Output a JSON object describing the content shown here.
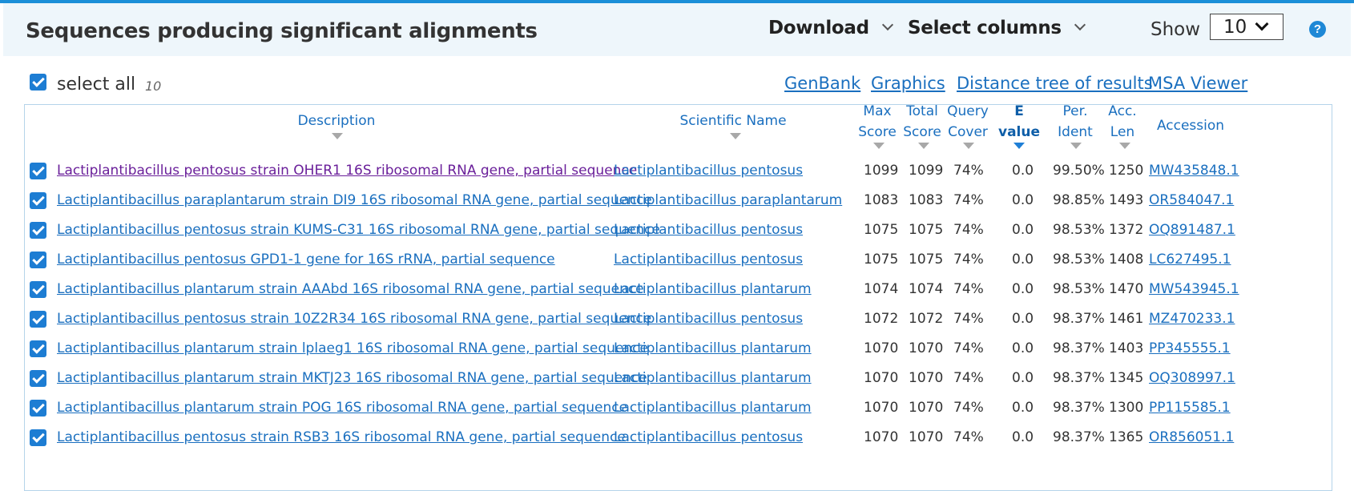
{
  "header": {
    "title": "Sequences producing significant alignments",
    "download_label": "Download",
    "select_columns_label": "Select columns",
    "show_label": "Show",
    "show_value": "10",
    "help_icon": "question-circle-icon"
  },
  "selection": {
    "select_all_label": "select all",
    "count": "10"
  },
  "links": {
    "genbank": "GenBank",
    "graphics": "Graphics",
    "distance_tree": "Distance tree of results",
    "msa_viewer": "MSA Viewer"
  },
  "columns": {
    "description": "Description",
    "scientific_name": "Scientific Name",
    "max_score_1": "Max",
    "max_score_2": "Score",
    "total_score_1": "Total",
    "total_score_2": "Score",
    "query_cover_1": "Query",
    "query_cover_2": "Cover",
    "evalue_1": "E",
    "evalue_2": "value",
    "per_ident_1": "Per.",
    "per_ident_2": "Ident",
    "acc_len_1": "Acc.",
    "acc_len_2": "Len",
    "accession": "Accession"
  },
  "rows": [
    {
      "description": "Lactiplantibacillus pentosus strain OHER1 16S ribosomal RNA gene, partial sequence",
      "scientific_name": "Lactiplantibacillus pentosus",
      "max_score": "1099",
      "total_score": "1099",
      "query_cover": "74%",
      "evalue": "0.0",
      "per_ident": "99.50%",
      "acc_len": "1250",
      "accession": "MW435848.1"
    },
    {
      "description": "Lactiplantibacillus paraplantarum strain DI9 16S ribosomal RNA gene, partial sequence",
      "scientific_name": "Lactiplantibacillus paraplantarum",
      "max_score": "1083",
      "total_score": "1083",
      "query_cover": "74%",
      "evalue": "0.0",
      "per_ident": "98.85%",
      "acc_len": "1493",
      "accession": "OR584047.1"
    },
    {
      "description": "Lactiplantibacillus pentosus strain KUMS-C31 16S ribosomal RNA gene, partial sequence",
      "scientific_name": "Lactiplantibacillus pentosus",
      "max_score": "1075",
      "total_score": "1075",
      "query_cover": "74%",
      "evalue": "0.0",
      "per_ident": "98.53%",
      "acc_len": "1372",
      "accession": "OQ891487.1"
    },
    {
      "description": "Lactiplantibacillus pentosus GPD1-1 gene for 16S rRNA, partial sequence",
      "scientific_name": "Lactiplantibacillus pentosus",
      "max_score": "1075",
      "total_score": "1075",
      "query_cover": "74%",
      "evalue": "0.0",
      "per_ident": "98.53%",
      "acc_len": "1408",
      "accession": "LC627495.1"
    },
    {
      "description": "Lactiplantibacillus plantarum strain AAAbd 16S ribosomal RNA gene, partial sequence",
      "scientific_name": "Lactiplantibacillus plantarum",
      "max_score": "1074",
      "total_score": "1074",
      "query_cover": "74%",
      "evalue": "0.0",
      "per_ident": "98.53%",
      "acc_len": "1470",
      "accession": "MW543945.1"
    },
    {
      "description": "Lactiplantibacillus pentosus strain 10Z2R34 16S ribosomal RNA gene, partial sequence",
      "scientific_name": "Lactiplantibacillus pentosus",
      "max_score": "1072",
      "total_score": "1072",
      "query_cover": "74%",
      "evalue": "0.0",
      "per_ident": "98.37%",
      "acc_len": "1461",
      "accession": "MZ470233.1"
    },
    {
      "description": "Lactiplantibacillus plantarum strain lplaeg1 16S ribosomal RNA gene, partial sequence",
      "scientific_name": "Lactiplantibacillus plantarum",
      "max_score": "1070",
      "total_score": "1070",
      "query_cover": "74%",
      "evalue": "0.0",
      "per_ident": "98.37%",
      "acc_len": "1403",
      "accession": "PP345555.1"
    },
    {
      "description": "Lactiplantibacillus plantarum strain MKTJ23 16S ribosomal RNA gene, partial sequence",
      "scientific_name": "Lactiplantibacillus plantarum",
      "max_score": "1070",
      "total_score": "1070",
      "query_cover": "74%",
      "evalue": "0.0",
      "per_ident": "98.37%",
      "acc_len": "1345",
      "accession": "OQ308997.1"
    },
    {
      "description": "Lactiplantibacillus plantarum strain POG 16S ribosomal RNA gene, partial sequence",
      "scientific_name": "Lactiplantibacillus plantarum",
      "max_score": "1070",
      "total_score": "1070",
      "query_cover": "74%",
      "evalue": "0.0",
      "per_ident": "98.37%",
      "acc_len": "1300",
      "accession": "PP115585.1"
    },
    {
      "description": "Lactiplantibacillus pentosus strain RSB3 16S ribosomal RNA gene, partial sequence",
      "scientific_name": "Lactiplantibacillus pentosus",
      "max_score": "1070",
      "total_score": "1070",
      "query_cover": "74%",
      "evalue": "0.0",
      "per_ident": "98.37%",
      "acc_len": "1365",
      "accession": "OR856051.1"
    }
  ]
}
